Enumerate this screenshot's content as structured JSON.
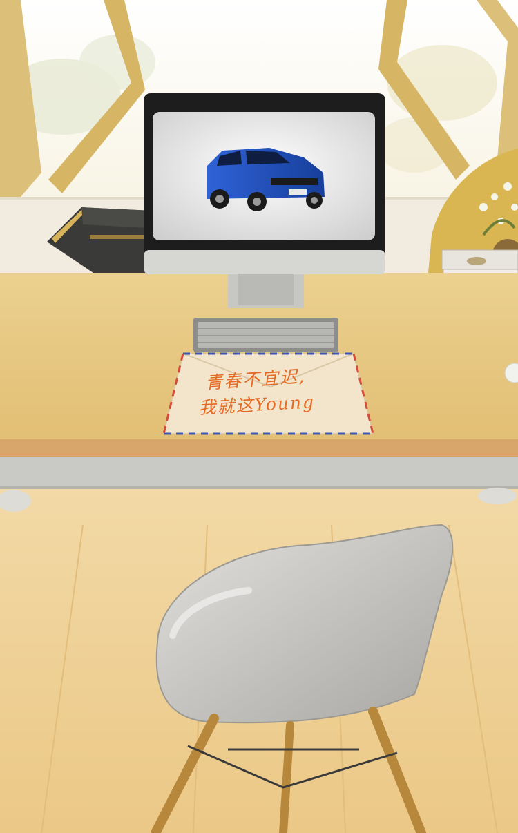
{
  "letter": {
    "line1": "青春不宜迟,",
    "line2": "我就这Young"
  },
  "colors": {
    "wall": "#f3e6c9",
    "window_frame": "#d8b66b",
    "desk_top": "#e6c57c",
    "desk_edge": "#d9a86a",
    "floor": "#efd29b",
    "chair": "#c9c7c3",
    "car": "#1e4fbf",
    "handwriting": "#e56a23"
  },
  "icons": {
    "monitor": "monitor-icon",
    "keyboard": "keyboard-icon",
    "chair": "chair-icon",
    "car": "car-icon",
    "envelope": "envelope-icon"
  }
}
